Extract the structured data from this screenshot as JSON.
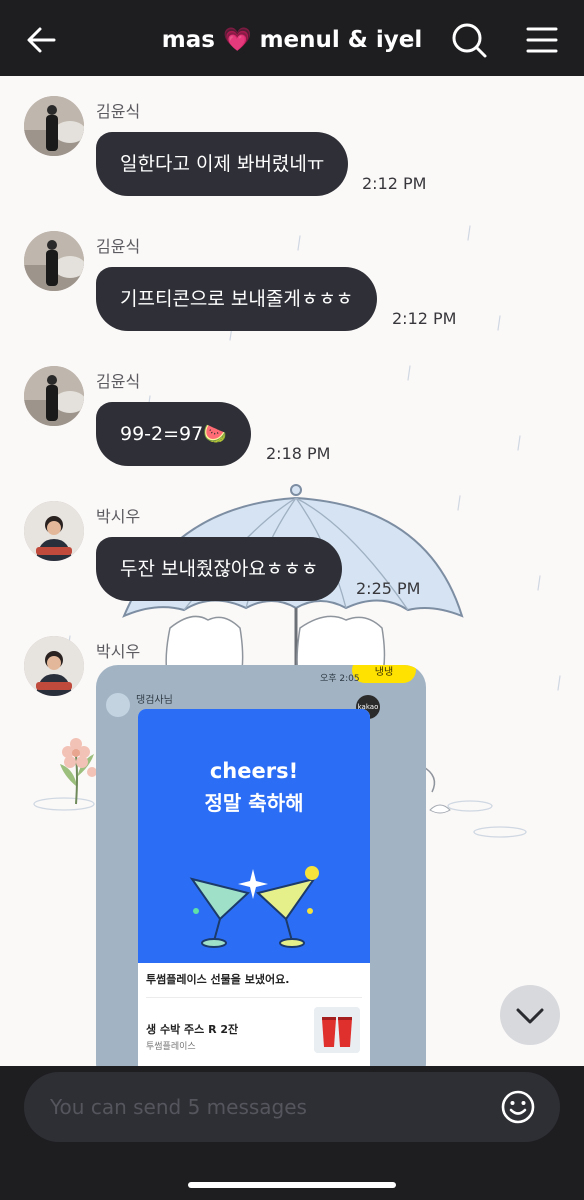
{
  "header": {
    "title": "mas 💗 menul & iyel"
  },
  "messages": [
    {
      "sender": "김윤식",
      "text": "일한다고 이제 봐버렸네ㅠ",
      "time": "2:12 PM"
    },
    {
      "sender": "김윤식",
      "text": "기프티콘으로 보내줄게ㅎㅎㅎ",
      "time": "2:12 PM"
    },
    {
      "sender": "김윤식",
      "text": "99-2=97🍉",
      "time": "2:18 PM"
    },
    {
      "sender": "박시우",
      "text": "두잔 보내줬잖아요ㅎㅎㅎ",
      "time": "2:25 PM"
    },
    {
      "sender": "박시우"
    }
  ],
  "gift": {
    "time": "오후 2:05",
    "tag": "냉냉",
    "sender": "댕검사님",
    "kakao": "kakao",
    "cheers": "cheers!",
    "congrats": "정말 축하해",
    "sent_text": "투썸플레이스 선물을 보냈어요.",
    "item_name": "생 수박 주스 R 2잔",
    "brand": "투썸플레이스"
  },
  "composer": {
    "placeholder": "You can send 5 messages"
  },
  "icons": {
    "back": "arrow-left-icon",
    "search": "search-icon",
    "menu": "hamburger-menu-icon",
    "scroll_down": "chevron-down-icon",
    "emoji": "smiley-icon"
  },
  "colors": {
    "header_bg": "#1e1e21",
    "bubble_bg": "#2f3037",
    "chat_bg": "#fbf8f8",
    "gift_blue": "#2b6ef5",
    "gift_yellow": "#ffe200"
  }
}
